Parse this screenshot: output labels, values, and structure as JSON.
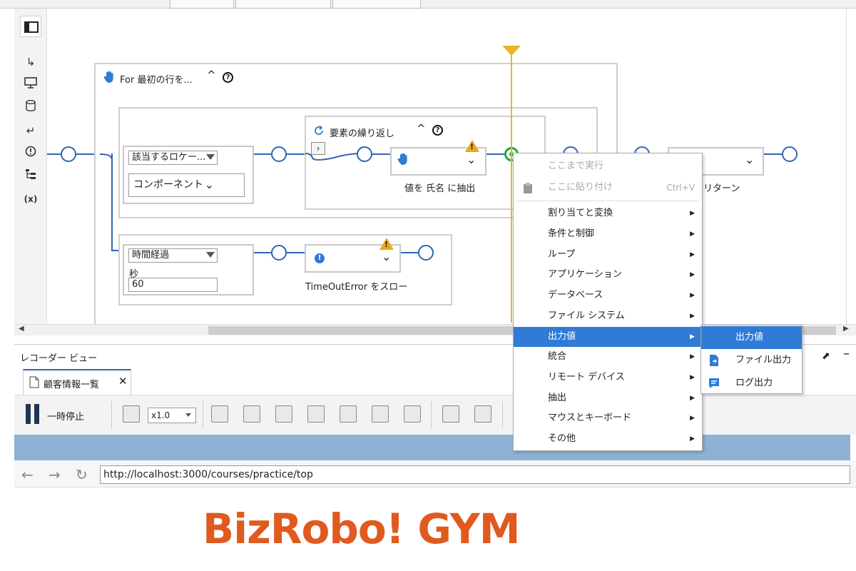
{
  "flow": {
    "loop_title": "For 最初の行を...",
    "component_select": "該当するロケー...",
    "component_field": "コンポーネント",
    "repeat_title": "要素の繰り返し",
    "extract_label": "値を 氏名 に抽出",
    "return_label": "リターン",
    "timer_select": "時間経過",
    "seconds_label": "秒",
    "seconds_value": "60",
    "throw_label": "TimeOutError をスロー"
  },
  "context_menu": {
    "items": [
      {
        "label": "ここまで実行",
        "state": "disabled"
      },
      {
        "label": "ここに貼り付け",
        "accel": "Ctrl+V",
        "state": "disabled"
      },
      {
        "label": "割り当てと変換"
      },
      {
        "label": "条件と制御"
      },
      {
        "label": "ループ"
      },
      {
        "label": "アプリケーション"
      },
      {
        "label": "データベース"
      },
      {
        "label": "ファイル システム"
      },
      {
        "label": "出力値",
        "state": "active"
      },
      {
        "label": "統合"
      },
      {
        "label": "リモート デバイス"
      },
      {
        "label": "抽出"
      },
      {
        "label": "マウスとキーボード"
      },
      {
        "label": "その他"
      }
    ],
    "submenu": [
      {
        "label": "出力値",
        "icon": "output-value-icon"
      },
      {
        "label": "ファイル出力",
        "icon": "file-output-icon"
      },
      {
        "label": "ログ出力",
        "icon": "log-output-icon"
      }
    ]
  },
  "recorder": {
    "title": "レコーダー ビュー",
    "tab_label": "顧客情報一覧",
    "pause_label": "一時停止",
    "speed": "x1.0",
    "url": "http://localhost:3000/courses/practice/top",
    "logo_text": "BizRobo! GYM"
  },
  "colors": {
    "flow_line": "#2f66b0",
    "menu_highlight": "#2f7bd6",
    "warning": "#e9a81b",
    "logo": "#e05a1f"
  }
}
